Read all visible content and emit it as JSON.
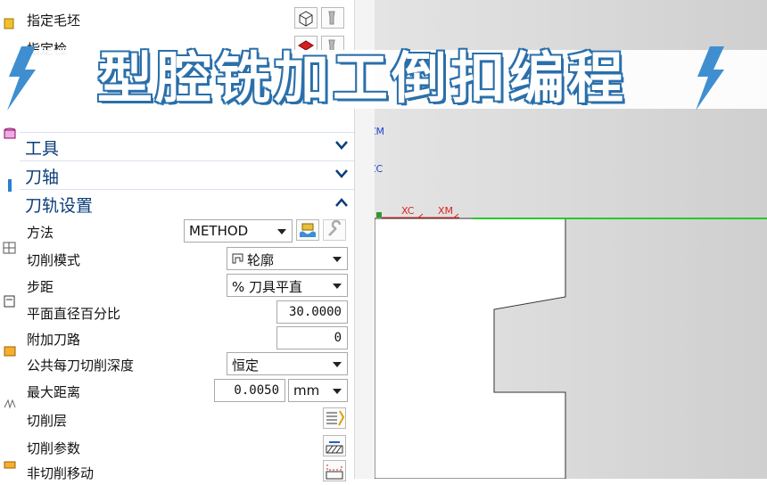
{
  "banner": {
    "title": "型腔铣加工倒扣编程"
  },
  "geometry_rows": {
    "blank": "指定毛坯",
    "check": "指定检"
  },
  "sections": {
    "tool": "工具",
    "axis": "刀轴",
    "path_settings": "刀轨设置"
  },
  "path_settings": {
    "method_label": "方法",
    "method_value": "METHOD",
    "cut_pattern_label": "切削模式",
    "cut_pattern_value": "轮廓",
    "stepover_label": "步距",
    "stepover_value": "% 刀具平直",
    "flat_diameter_label": "平面直径百分比",
    "flat_diameter_value": "30.0000",
    "additional_passes_label": "附加刀路",
    "additional_passes_value": "0",
    "depth_per_cut_label": "公共每刀切削深度",
    "depth_per_cut_value": "恒定",
    "max_distance_label": "最大距离",
    "max_distance_value": "0.0050",
    "max_distance_unit": "mm",
    "cut_levels_label": "切削层",
    "cut_params_label": "切削参数",
    "non_cutting_label": "非切削移动"
  },
  "viewport": {
    "labels": [
      "XC",
      "XM",
      "ZM",
      "ZC"
    ],
    "axis_line_color": "#22cc22",
    "axis_x_color": "#dd2222"
  },
  "colors": {
    "section_title": "#0a3d78",
    "banner_fill": "#ffffff",
    "banner_outline": "#3f8fd0",
    "lightning": "#3f8fd0"
  }
}
